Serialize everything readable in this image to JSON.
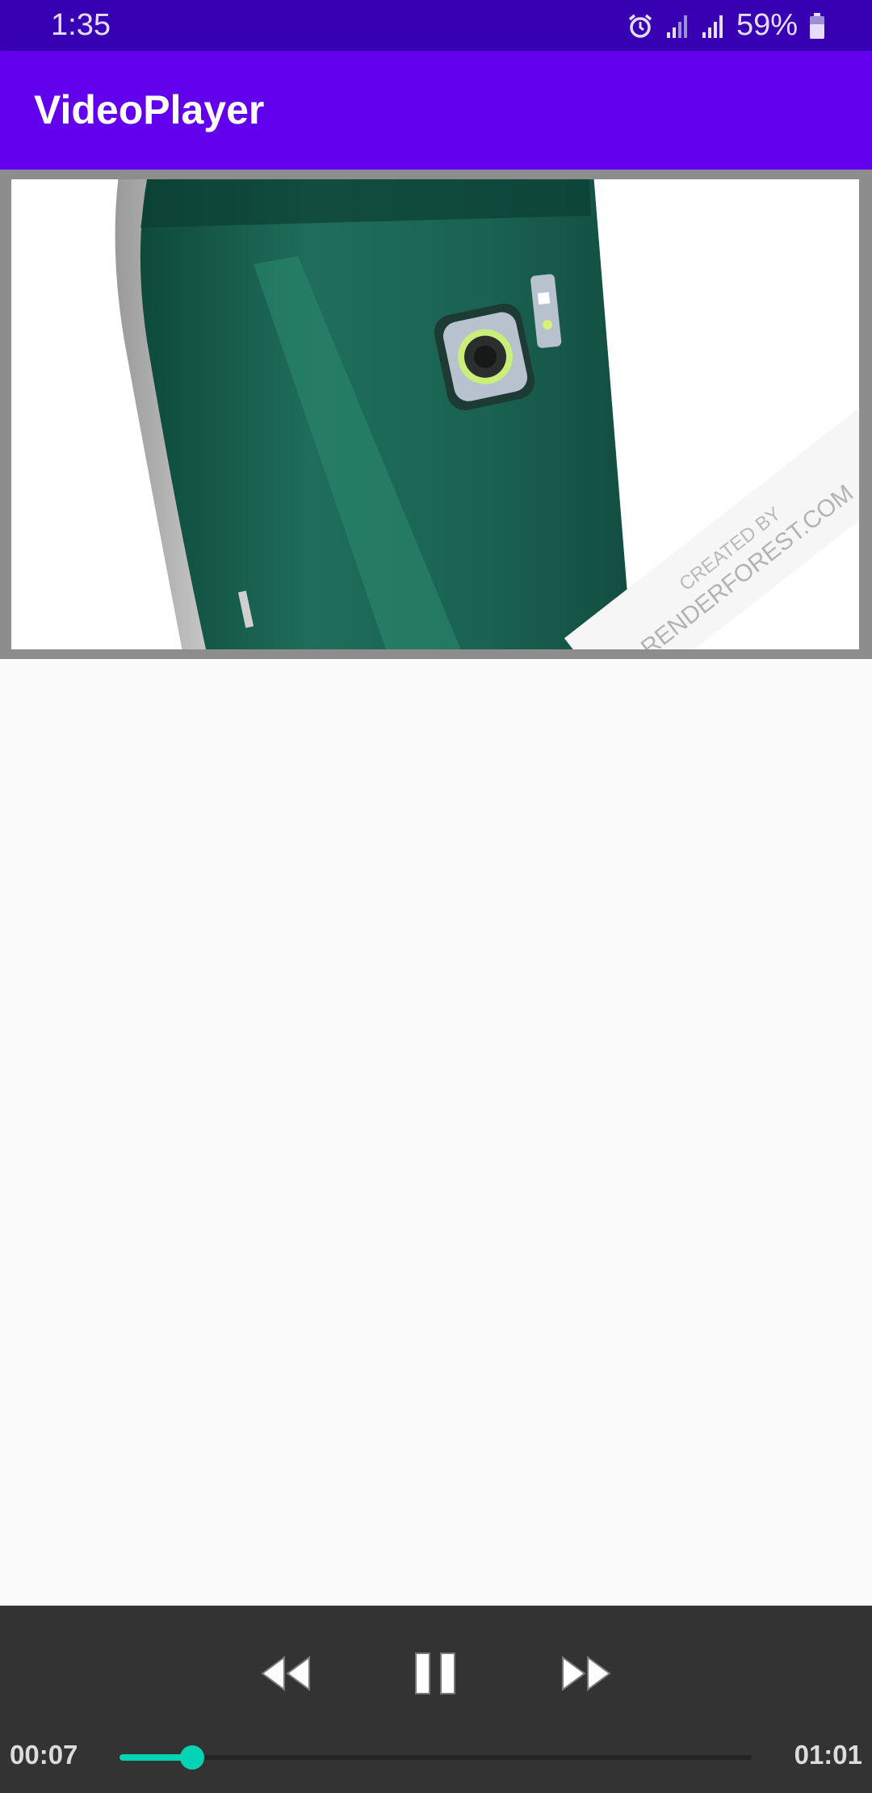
{
  "status_bar": {
    "time": "1:35",
    "battery_percent": "59%",
    "icons": [
      "alarm-icon",
      "signal-icon",
      "signal-icon",
      "battery-icon"
    ]
  },
  "app_bar": {
    "title": "VideoPlayer"
  },
  "video": {
    "watermark_line1": "CREATED BY",
    "watermark_line2": "RENDERFOREST.COM"
  },
  "controls": {
    "current_time": "00:07",
    "total_time": "01:01",
    "progress": 0.115,
    "buttons": [
      "rewind-icon",
      "pause-icon",
      "fast-forward-icon"
    ]
  },
  "colors": {
    "status_bar": "#3700b3",
    "app_bar": "#6200ee",
    "seek_accent": "#00d4b5",
    "controls_bg": "#333333"
  }
}
